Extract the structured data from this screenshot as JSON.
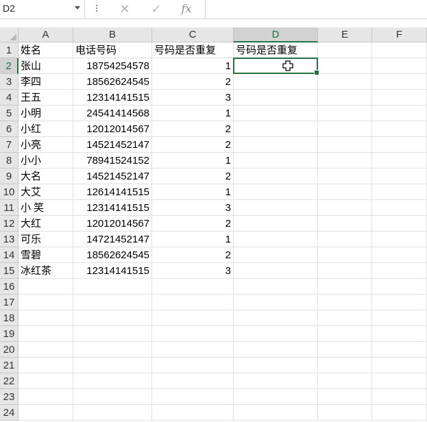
{
  "formula_bar": {
    "name_box": "D2",
    "cancel_icon": "✕",
    "enter_icon": "✓",
    "fx_label": "fx",
    "formula": ""
  },
  "columns": [
    "A",
    "B",
    "C",
    "D",
    "E",
    "F"
  ],
  "active_cell": "D2",
  "rows": [
    {
      "n": "1",
      "a": "姓名",
      "b": "电话号码",
      "c": "号码是否重复",
      "d": "号码是否重复"
    },
    {
      "n": "2",
      "a": "张山",
      "b": "18754254578",
      "c": "1",
      "d": ""
    },
    {
      "n": "3",
      "a": "李四",
      "b": "18562624545",
      "c": "2",
      "d": ""
    },
    {
      "n": "4",
      "a": "王五",
      "b": "12314141515",
      "c": "3",
      "d": ""
    },
    {
      "n": "5",
      "a": "小明",
      "b": "24541414568",
      "c": "1",
      "d": ""
    },
    {
      "n": "6",
      "a": "小红",
      "b": "12012014567",
      "c": "2",
      "d": ""
    },
    {
      "n": "7",
      "a": "小亮",
      "b": "14521452147",
      "c": "2",
      "d": ""
    },
    {
      "n": "8",
      "a": "小小",
      "b": "78941524152",
      "c": "1",
      "d": ""
    },
    {
      "n": "9",
      "a": "大名",
      "b": "14521452147",
      "c": "2",
      "d": ""
    },
    {
      "n": "10",
      "a": "大艾",
      "b": "12614141515",
      "c": "1",
      "d": ""
    },
    {
      "n": "11",
      "a": "小 笑",
      "b": "12314141515",
      "c": "3",
      "d": ""
    },
    {
      "n": "12",
      "a": "大红",
      "b": "12012014567",
      "c": "2",
      "d": ""
    },
    {
      "n": "13",
      "a": "可乐",
      "b": "14721452147",
      "c": "1",
      "d": ""
    },
    {
      "n": "14",
      "a": "雪碧",
      "b": "18562624545",
      "c": "2",
      "d": ""
    },
    {
      "n": "15",
      "a": "冰红茶",
      "b": "12314141515",
      "c": "3",
      "d": ""
    },
    {
      "n": "16",
      "a": "",
      "b": "",
      "c": "",
      "d": ""
    },
    {
      "n": "17",
      "a": "",
      "b": "",
      "c": "",
      "d": ""
    },
    {
      "n": "18",
      "a": "",
      "b": "",
      "c": "",
      "d": ""
    },
    {
      "n": "19",
      "a": "",
      "b": "",
      "c": "",
      "d": ""
    },
    {
      "n": "20",
      "a": "",
      "b": "",
      "c": "",
      "d": ""
    },
    {
      "n": "21",
      "a": "",
      "b": "",
      "c": "",
      "d": ""
    },
    {
      "n": "22",
      "a": "",
      "b": "",
      "c": "",
      "d": ""
    },
    {
      "n": "23",
      "a": "",
      "b": "",
      "c": "",
      "d": ""
    },
    {
      "n": "24",
      "a": "",
      "b": "",
      "c": "",
      "d": ""
    }
  ],
  "colors": {
    "accent": "#217346",
    "header_bg": "#e6e6e6",
    "gridline": "#e1e1e1"
  }
}
